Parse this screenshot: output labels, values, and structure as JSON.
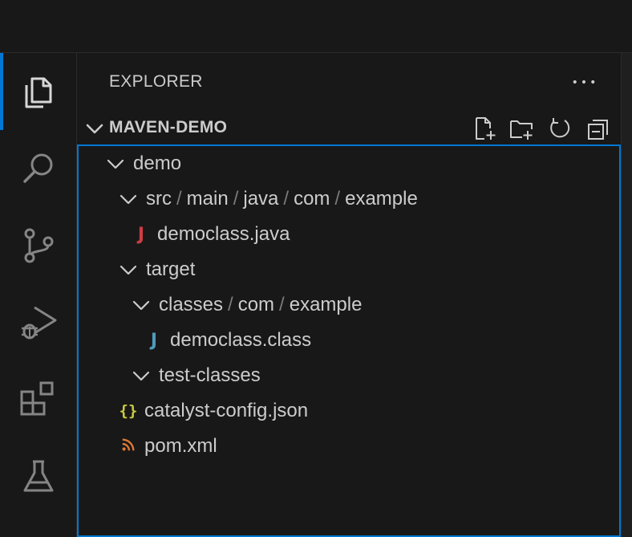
{
  "activity_bar": {
    "items": [
      {
        "name": "explorer",
        "icon": "files-icon",
        "active": true
      },
      {
        "name": "search",
        "icon": "search-icon",
        "active": false
      },
      {
        "name": "source-control",
        "icon": "source-control-icon",
        "active": false
      },
      {
        "name": "run-and-debug",
        "icon": "run-debug-icon",
        "active": false
      },
      {
        "name": "extensions",
        "icon": "extensions-icon",
        "active": false
      },
      {
        "name": "testing",
        "icon": "beaker-icon",
        "active": false
      }
    ]
  },
  "explorer": {
    "title": "EXPLORER",
    "more_icon": "ellipsis-icon",
    "section": {
      "title": "MAVEN-DEMO",
      "tools": [
        "new-file-icon",
        "new-folder-icon",
        "refresh-icon",
        "collapse-all-icon"
      ]
    },
    "tree": {
      "demo": "demo",
      "src_path": [
        "src",
        "main",
        "java",
        "com",
        "example"
      ],
      "separator": "/",
      "democlass_java": "democlass.java",
      "target": "target",
      "classes_path": [
        "classes",
        "com",
        "example"
      ],
      "democlass_class": "democlass.class",
      "test_classes": "test-classes",
      "catalyst_config": "catalyst-config.json",
      "pom": "pom.xml"
    },
    "file_icons": {
      "java": "J",
      "json": "{}",
      "xml": "rss-icon"
    }
  },
  "colors": {
    "accent": "#0078d4",
    "background": "#181818",
    "java_red": "#cc3e44",
    "java_blue": "#519aba",
    "json_yellow": "#cbcb41",
    "xml_orange": "#e37933"
  }
}
